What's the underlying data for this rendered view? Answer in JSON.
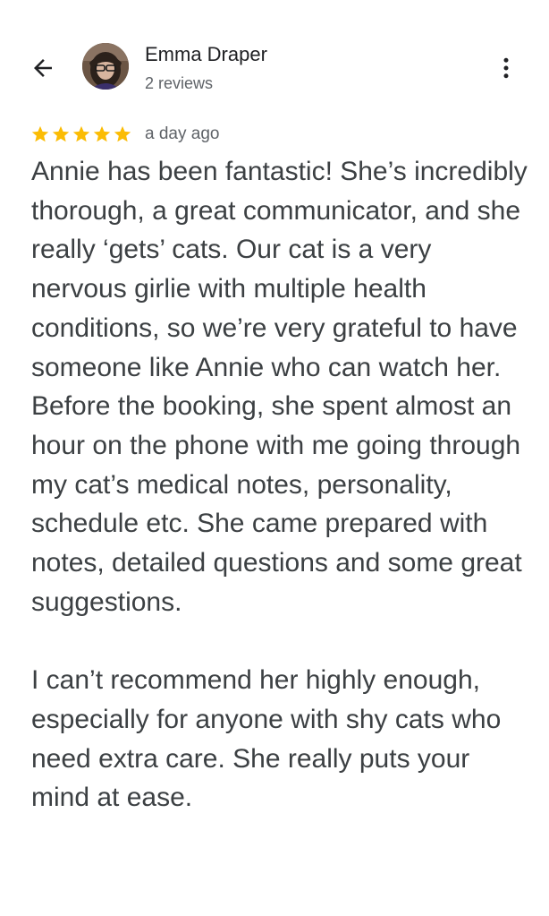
{
  "header": {
    "reviewer_name": "Emma Draper",
    "review_count": "2 reviews",
    "back_icon": "arrow-left-icon",
    "more_icon": "more-vert-icon"
  },
  "review": {
    "rating": 5,
    "max_rating": 5,
    "star_color": "#fbbc04",
    "time": "a day ago",
    "paragraphs": [
      "Annie has been fantastic! She’s incredibly thorough, a great communicator, and she really ‘gets’ cats. Our cat is a very nervous girlie with multiple health conditions, so we’re very grateful to have someone like Annie who can watch her. Before the booking, she spent almost an hour on the phone with me going through my cat’s medical notes, personality, schedule etc. She came prepared with notes, detailed questions and some great suggestions.",
      "I can’t recommend her highly enough, especially for anyone with shy cats who need extra care. She really puts your mind at ease."
    ]
  }
}
